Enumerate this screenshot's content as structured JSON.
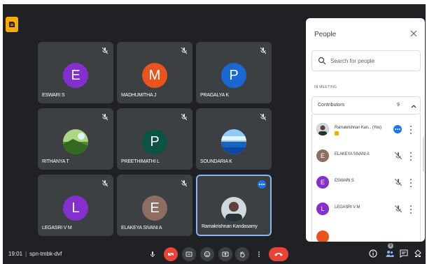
{
  "meeting": {
    "time": "19:01",
    "code": "spn-tmbk-dvf"
  },
  "tiles": [
    {
      "name": "ESWARI S",
      "initial": "E",
      "color": "#8430ce"
    },
    {
      "name": "MADHUMITHA J",
      "initial": "M",
      "color": "#e8541c"
    },
    {
      "name": "PRAGALYA K",
      "initial": "P",
      "color": "#1967d2"
    },
    {
      "name": "RITHANYA T",
      "initial": "",
      "color": "#7cb342"
    },
    {
      "name": "PREETHIMATHI L",
      "initial": "P",
      "color": "#0b5345"
    },
    {
      "name": "SOUNDARIA K",
      "initial": "",
      "color": "#2e6fb5"
    },
    {
      "name": "LEGASRI V M",
      "initial": "L",
      "color": "#8430ce"
    },
    {
      "name": "ELAKEYA SIVANI A",
      "initial": "E",
      "color": "#8d6e63"
    },
    {
      "name": "Ramakrishnan Kandasamy",
      "initial": "",
      "color": "#5d4037"
    }
  ],
  "people_panel": {
    "title": "People",
    "search_placeholder": "Search for people",
    "section_label": "IN MEETING",
    "group_label": "Contributors",
    "group_count": "9",
    "list": [
      {
        "name": "Ramakrishnan Kan... (You)",
        "initial": "",
        "color": "#5d4037"
      },
      {
        "name": "ELAKEYA SIVANI A",
        "initial": "E",
        "color": "#8d6e63"
      },
      {
        "name": "ESWARI S",
        "initial": "E",
        "color": "#8430ce"
      },
      {
        "name": "LEGASRI V M",
        "initial": "L",
        "color": "#8430ce"
      }
    ]
  },
  "people_badge": "9",
  "colors": {
    "stage": "#202124",
    "tile": "#3c4043",
    "accent": "#1a73e8",
    "danger": "#ea4335",
    "host": "#f9ab00"
  },
  "icons": [
    "mic-off-icon",
    "mic-icon",
    "camera-off-icon",
    "captions-icon",
    "emoji-icon",
    "present-icon",
    "raise-hand-icon",
    "more-icon",
    "end-call-icon",
    "info-icon",
    "people-icon",
    "chat-icon",
    "activities-icon",
    "search-icon",
    "close-icon",
    "chevron-up-icon"
  ]
}
